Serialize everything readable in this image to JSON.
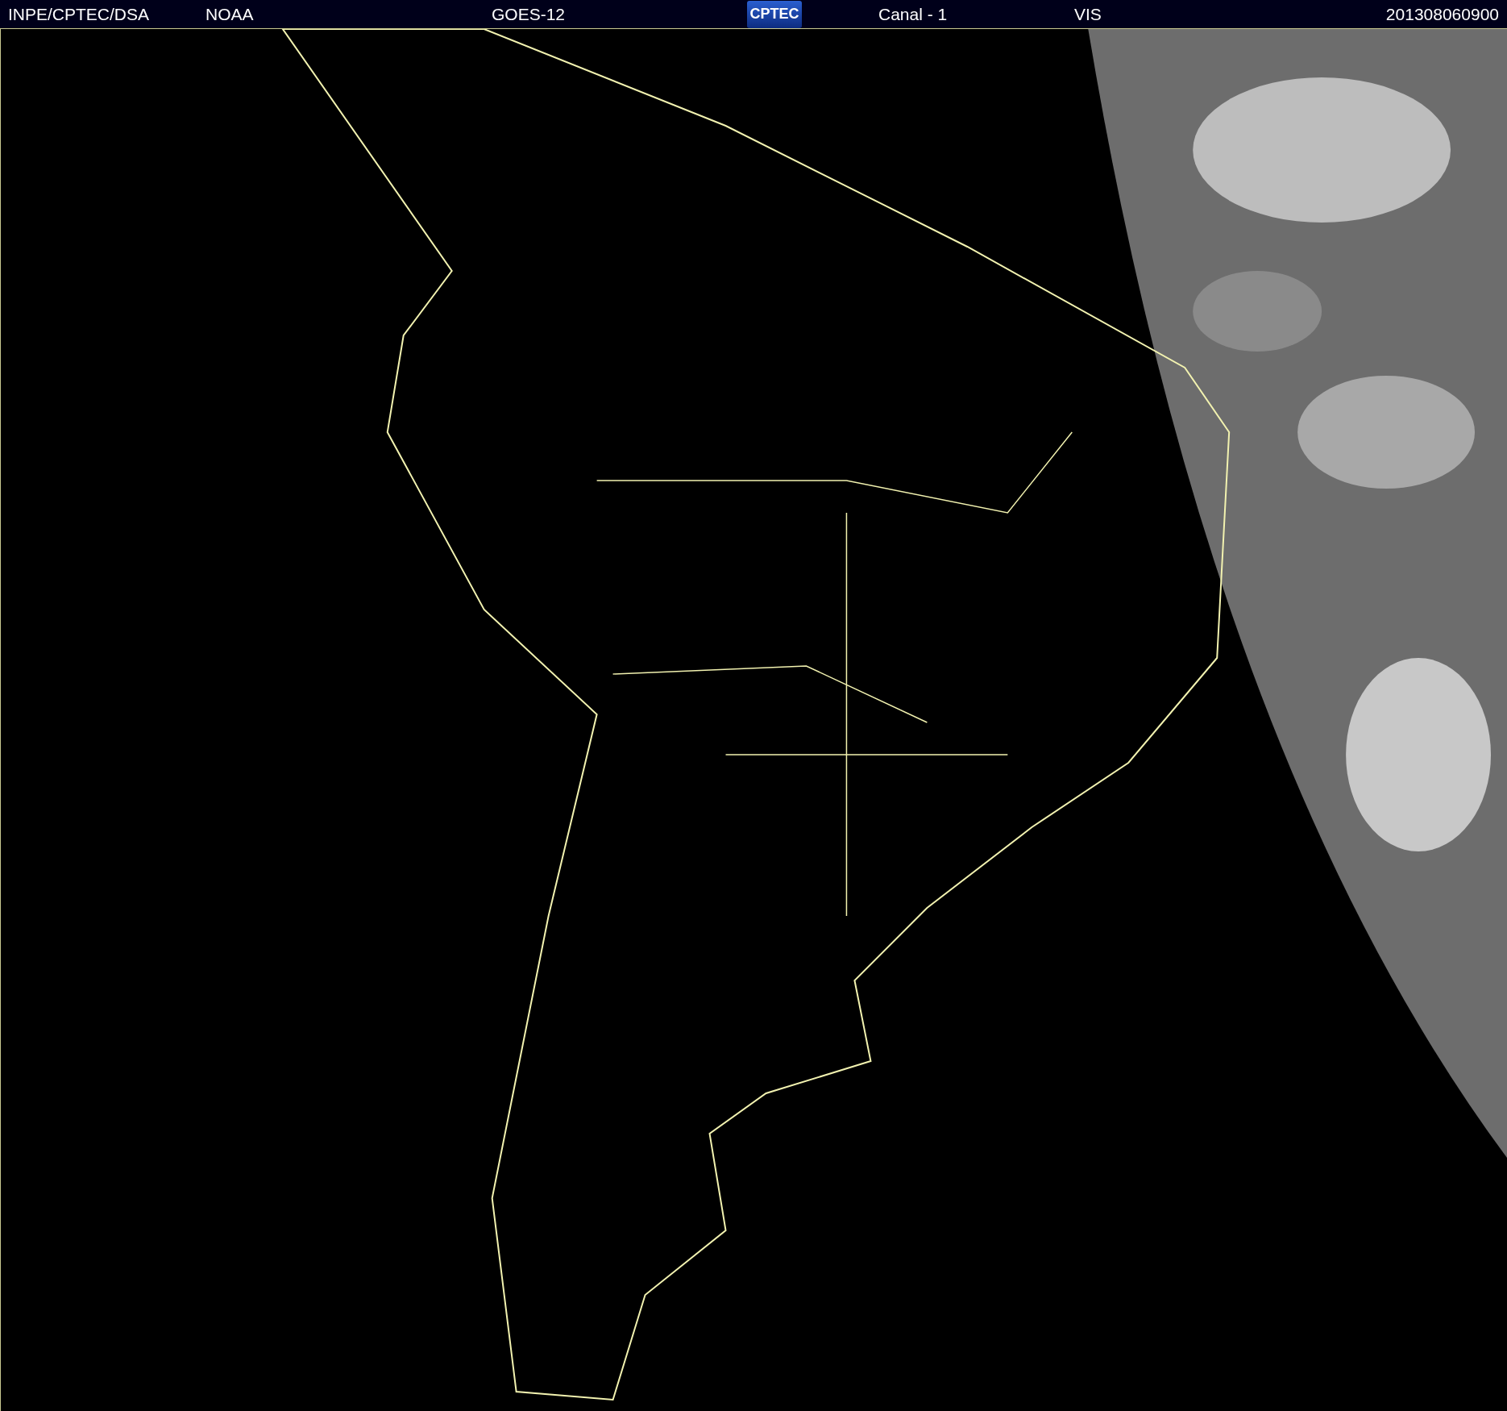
{
  "header": {
    "source": "INPE/CPTEC/DSA",
    "agency": "NOAA",
    "satellite": "GOES-12",
    "logo": "CPTEC",
    "channel": "Canal - 1",
    "band": "VIS",
    "timestamp": "201308060900"
  }
}
